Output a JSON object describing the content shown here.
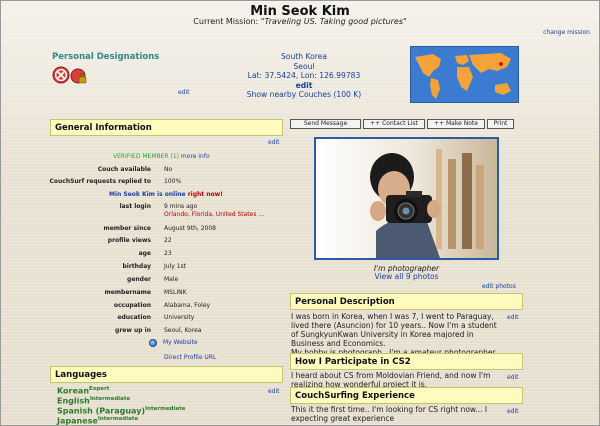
{
  "profile": {
    "name": "Min Seok Kim",
    "mission_label": "Current Mission:",
    "mission_text": "\"Traveling US. Taking good pictures\"",
    "change_mission": "change mission"
  },
  "designations": {
    "title": "Personal Designations",
    "edit": "edit"
  },
  "location": {
    "country": "South Korea",
    "city": "Seoul",
    "coords": "Lat: 37.5424, Lon: 126.99783",
    "edit": "edit",
    "nearby": "Show nearby Couches (100 K)"
  },
  "general": {
    "title": "General Information",
    "edit": "edit",
    "verified": "VERIFIED MEMBER (1)",
    "more_info": "more info",
    "couch_available_label": "Couch available",
    "couch_available": "No",
    "requests_label": "CouchSurf requests replied to",
    "requests": "100%",
    "online_name": "Min Seok Kim is online",
    "online_now": "right now!",
    "last_login_label": "last login",
    "last_login": "9 mins ago",
    "last_location": "Orlando, Florida, United States ...",
    "member_since_label": "member since",
    "member_since": "August 9th, 2008",
    "profile_views_label": "profile views",
    "profile_views": "22",
    "age_label": "age",
    "age": "23",
    "birthday_label": "birthday",
    "birthday": "July 1st",
    "gender_label": "gender",
    "gender": "Male",
    "membername_label": "membername",
    "membername": "MSLINK",
    "occupation_label": "occupation",
    "occupation": "Alabama, Foley",
    "education_label": "education",
    "education": "University",
    "grew_up_label": "grew up in",
    "grew_up": "Seoul, Korea",
    "my_website": "My Website",
    "direct_url": "Direct Profile URL"
  },
  "languages": {
    "title": "Languages",
    "edit": "edit",
    "items": [
      {
        "name": "Korean",
        "level": "Expert"
      },
      {
        "name": "English",
        "level": "Intermediate"
      },
      {
        "name": "Spanish (Paraguay)",
        "level": "Intermediate"
      },
      {
        "name": "Japanese",
        "level": "Intermediate"
      }
    ]
  },
  "actions": {
    "send_message": "Send Message",
    "contact_list": "++ Contact List",
    "make_note": "++ Make Note",
    "print": "Print"
  },
  "photo": {
    "caption": "I'm photographer",
    "view_all": "View all 9 photos",
    "edit": "edit photos"
  },
  "personal_description": {
    "title": "Personal Description",
    "text": "I was born in Korea, when I was 7, I went to Paraguay, lived there (Asuncion) for 10 years.. Now I'm a student of SungkyunKwan University in Korea majored in Business and Economics.\nMy hobby is photograph.. I'm a amateur photographer.",
    "edit": "edit"
  },
  "participate": {
    "title": "How I Participate in CS2",
    "text": "I heard about CS from Moldovian Friend, and now I'm realizing how wonderful project it is.",
    "edit": "edit"
  },
  "experience": {
    "title": "CouchSurfing Experience",
    "text": "This it the first time.. I'm looking for CS right now... I expecting great experience",
    "edit": "edit"
  },
  "colors": {
    "link": "#1a3fa3",
    "header_bg": "#fffbbf",
    "designation_title": "#2b8a8a",
    "online": "#c00000",
    "verified": "#2f9f2f",
    "language": "#2b7a2b"
  }
}
